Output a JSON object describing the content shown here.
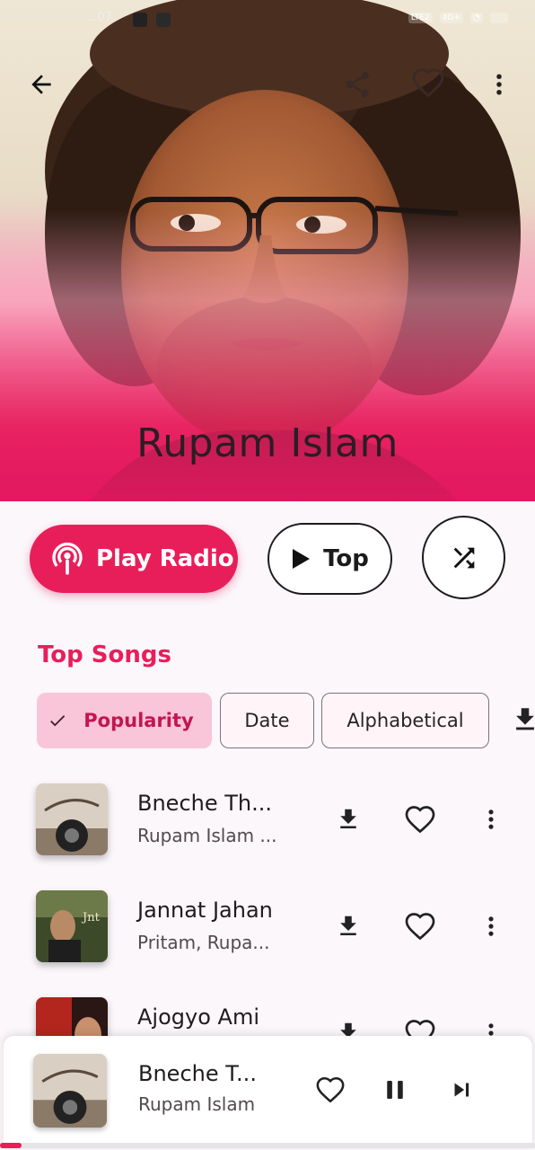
{
  "status_bar": {
    "time": "...07"
  },
  "artist": {
    "name": "Rupam Islam"
  },
  "actions": {
    "play_radio": "Play Radio",
    "top": "Top"
  },
  "top_songs": {
    "title": "Top Songs",
    "sort_chips": [
      {
        "label": "Popularity",
        "selected": true
      },
      {
        "label": "Date",
        "selected": false
      },
      {
        "label": "Alphabetical",
        "selected": false
      }
    ],
    "songs": [
      {
        "title": "Bneche Th...",
        "subtitle": "Rupam Islam ..."
      },
      {
        "title": "Jannat Jahan",
        "subtitle": "Pritam, Rupa..."
      },
      {
        "title": "Ajogyo Ami",
        "subtitle": ""
      }
    ]
  },
  "mini_player": {
    "title": "Bneche T...",
    "artist": "Rupam Islam",
    "progress": 0.04
  },
  "colors": {
    "accent": "#e81e5a",
    "chip_selected_bg": "#f9c5d8",
    "background": "#fbf7fb"
  },
  "icons": [
    "arrow-back",
    "share",
    "heart-outline",
    "more-vertical",
    "podcast",
    "play",
    "shuffle",
    "check",
    "download",
    "pause",
    "skip-next"
  ]
}
